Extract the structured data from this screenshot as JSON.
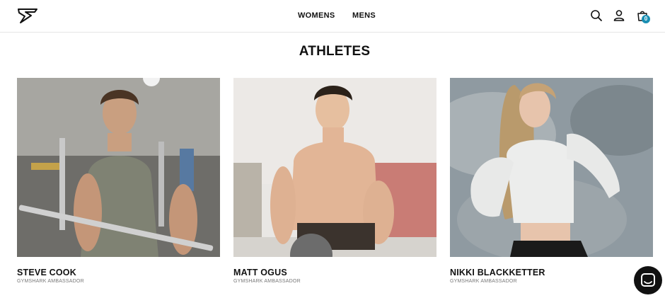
{
  "header": {
    "logo_icon": "gymshark-logo-icon",
    "nav": [
      {
        "label": "WOMENS"
      },
      {
        "label": "MENS"
      }
    ],
    "icons": [
      "search-icon",
      "account-icon",
      "bag-icon"
    ],
    "cart_count": "0",
    "accent_color": "#1a8fb3"
  },
  "main": {
    "title": "ATHLETES",
    "athletes": [
      {
        "name": "STEVE COOK",
        "role": "GYMSHARK AMBASSADOR"
      },
      {
        "name": "MATT OGUS",
        "role": "GYMSHARK AMBASSADOR"
      },
      {
        "name": "NIKKI BLACKKETTER",
        "role": "GYMSHARK AMBASSADOR"
      }
    ]
  },
  "chat": {
    "icon": "chat-bubble-icon"
  }
}
